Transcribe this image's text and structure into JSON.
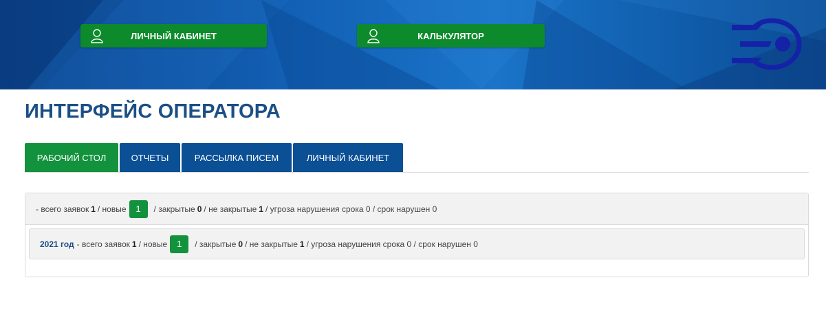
{
  "header": {
    "cabinet_label": "ЛИЧНЫЙ КАБИНЕТ",
    "calculator_label": "КАЛЬКУЛЯТОР",
    "button_icon": "user-icon",
    "logo_icon": "company-logo",
    "colors": {
      "button_bg": "#0d8a2b",
      "banner_bg": "#1260b5"
    }
  },
  "page_title": "ИНТЕРФЕЙС ОПЕРАТОРА",
  "tabs": [
    {
      "label": "РАБОЧИЙ СТОЛ",
      "active": true
    },
    {
      "label": "ОТЧЕТЫ",
      "active": false
    },
    {
      "label": "РАССЫЛКА ПИСЕМ",
      "active": false
    },
    {
      "label": "ЛИЧНЫЙ КАБИНЕТ",
      "active": false
    }
  ],
  "summary": {
    "prefix": "- всего заявок",
    "total": "1",
    "new_label": "/ новые",
    "new_count": "1",
    "closed_label": "/ закрытые",
    "closed": "0",
    "open_label": "/ не закрытые",
    "open": "1",
    "rest": "/ угроза нарушения срока 0 / срок нарушен 0"
  },
  "years": [
    {
      "year": "2021 год",
      "prefix": "- всего заявок",
      "total": "1",
      "new_label": "/ новые",
      "new_count": "1",
      "closed_label": "/ закрытые",
      "closed": "0",
      "open_label": "/ не закрытые",
      "open": "1",
      "rest": "/ угроза нарушения срока 0 / срок нарушен 0"
    }
  ],
  "colors": {
    "tab_active": "#13923d",
    "tab_inactive": "#0b4f94",
    "title": "#1b4f86"
  }
}
